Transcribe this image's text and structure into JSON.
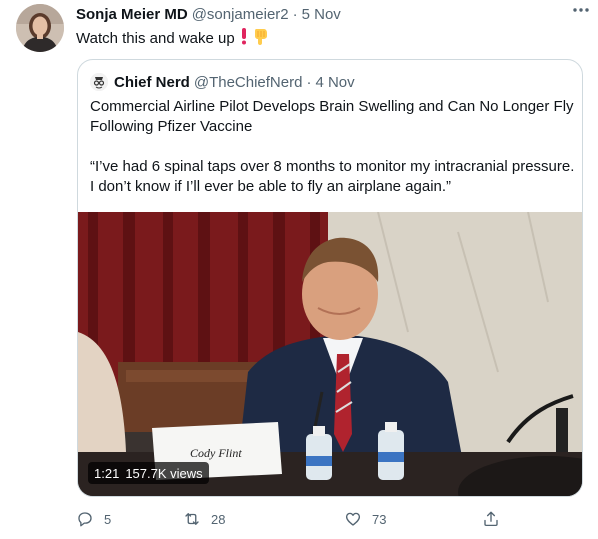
{
  "tweet": {
    "author_name": "Sonja Meier MD",
    "author_handle": "@sonjameier2",
    "separator": "·",
    "date": "5 Nov",
    "text": "Watch this and wake up",
    "more_label": "···",
    "icons": [
      "more-icon",
      "exclamation-emoji",
      "pointing-down-emoji"
    ]
  },
  "quote": {
    "author_name": "Chief Nerd",
    "author_handle": "@TheChiefNerd",
    "separator": "·",
    "date": "4 Nov",
    "headline": "Commercial Airline Pilot Develops Brain Swelling and Can No Longer Fly Following Pfizer Vaccine",
    "quote_text": "“I’ve had 6 spinal taps over 8 months to monitor my intracranial pressure. I don’t know if I’ll ever be able to fly an airplane again.”",
    "video": {
      "duration": "1:21",
      "views": "157.7K views",
      "name_card": "Cody Flint"
    }
  },
  "actions": {
    "reply_count": "5",
    "retweet_count": "28",
    "like_count": "73",
    "icons": [
      "reply-icon",
      "retweet-icon",
      "like-icon",
      "share-icon"
    ]
  },
  "colors": {
    "text_primary": "#0f1419",
    "text_secondary": "#536471",
    "border": "#cfd9de",
    "exclamation": "#e0245e"
  }
}
